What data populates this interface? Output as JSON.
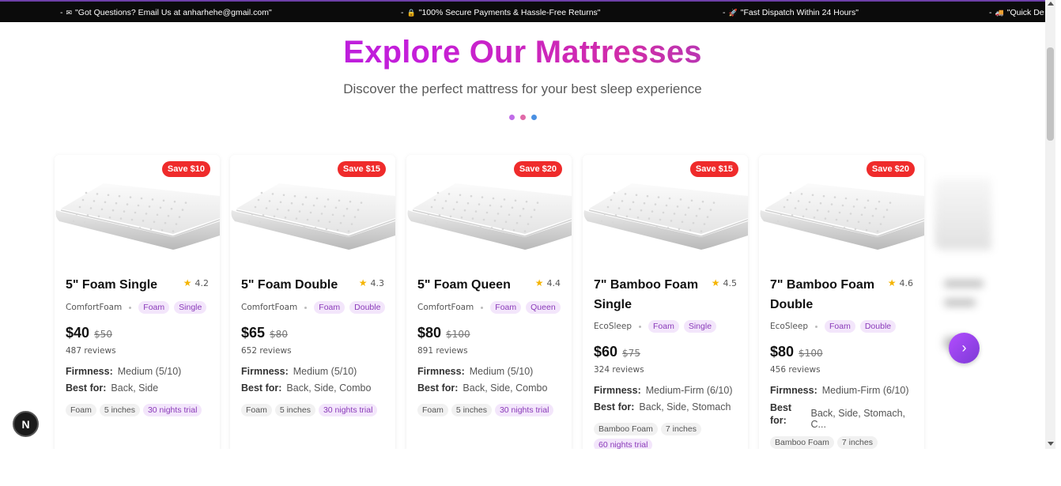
{
  "topbar": {
    "messages": [
      {
        "icon": "envelope-icon",
        "glyph": "✉",
        "text": "\"Got Questions? Email Us at anharhehe@gmail.com\""
      },
      {
        "icon": "lock-icon",
        "glyph": "🔒",
        "text": "\"100% Secure Payments & Hassle-Free Returns\""
      },
      {
        "icon": "rocket-icon",
        "glyph": "🚀",
        "text": "\"Fast Dispatch Within 24 Hours\""
      },
      {
        "icon": "truck-icon",
        "glyph": "🚚",
        "text": "\"Quick De"
      }
    ],
    "bullet": "-"
  },
  "hero": {
    "title": "Explore Our Mattresses",
    "subtitle": "Discover the perfect mattress for your best sleep experience",
    "dot_colors": [
      "#c06ce8",
      "#e06aa8",
      "#4a90e2"
    ]
  },
  "labels": {
    "firmness": "Firmness:",
    "best_for": "Best for:",
    "best_for_short": "Best for:"
  },
  "products": [
    {
      "save": "Save $10",
      "name": "5\" Foam Single",
      "rating": "4.2",
      "brand": "ComfortFoam",
      "material": "Foam",
      "size": "Single",
      "price": "$40",
      "old_price": "$50",
      "reviews": "487 reviews",
      "firmness": "Medium (5/10)",
      "best_for": "Back, Side",
      "tags": [
        "Foam",
        "5 inches"
      ],
      "trial": "30 nights trial"
    },
    {
      "save": "Save $15",
      "name": "5\" Foam Double",
      "rating": "4.3",
      "brand": "ComfortFoam",
      "material": "Foam",
      "size": "Double",
      "price": "$65",
      "old_price": "$80",
      "reviews": "652 reviews",
      "firmness": "Medium (5/10)",
      "best_for": "Back, Side, Combo",
      "tags": [
        "Foam",
        "5 inches"
      ],
      "trial": "30 nights trial"
    },
    {
      "save": "Save $20",
      "name": "5\" Foam Queen",
      "rating": "4.4",
      "brand": "ComfortFoam",
      "material": "Foam",
      "size": "Queen",
      "price": "$80",
      "old_price": "$100",
      "reviews": "891 reviews",
      "firmness": "Medium (5/10)",
      "best_for": "Back, Side, Combo",
      "tags": [
        "Foam",
        "5 inches"
      ],
      "trial": "30 nights trial"
    },
    {
      "save": "Save $15",
      "name": "7\" Bamboo Foam Single",
      "rating": "4.5",
      "brand": "EcoSleep",
      "material": "Foam",
      "size": "Single",
      "price": "$60",
      "old_price": "$75",
      "reviews": "324 reviews",
      "firmness": "Medium-Firm (6/10)",
      "best_for": "Back, Side, Stomach",
      "tags": [
        "Bamboo Foam",
        "7 inches"
      ],
      "trial": "60 nights trial"
    },
    {
      "save": "Save $20",
      "name": "7\" Bamboo Foam Double",
      "rating": "4.6",
      "brand": "EcoSleep",
      "material": "Foam",
      "size": "Double",
      "price": "$80",
      "old_price": "$100",
      "reviews": "456 reviews",
      "firmness": "Medium-Firm (6/10)",
      "best_for": "Back, Side, Stomach, C...",
      "tags": [
        "Bamboo Foam",
        "7 inches"
      ],
      "trial": ""
    }
  ],
  "next_button": {
    "icon": "chevron-right-icon",
    "glyph": "›"
  },
  "badge": {
    "letter": "N"
  }
}
